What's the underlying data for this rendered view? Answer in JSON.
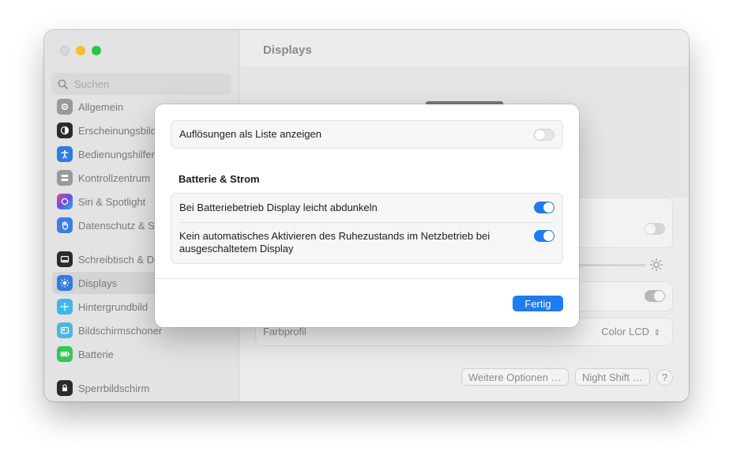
{
  "sidebar": {
    "search_placeholder": "Suchen",
    "items": [
      {
        "label": "Allgemein",
        "icon": "gear-icon",
        "color": "#9a9a9a"
      },
      {
        "label": "Erscheinungsbild",
        "icon": "appearance-icon",
        "color": "#2b2b2b"
      },
      {
        "label": "Bedienungshilfen",
        "icon": "accessibility-icon",
        "color": "#2f7be0"
      },
      {
        "label": "Kontrollzentrum",
        "icon": "control-center-icon",
        "color": "#9a9a9a"
      },
      {
        "label": "Siri & Spotlight",
        "icon": "siri-icon",
        "color": "#a04ddb"
      },
      {
        "label": "Datenschutz & Sicherheit",
        "icon": "hand-icon",
        "color": "#3a7ee6"
      },
      {
        "label": "Schreibtisch & Dock",
        "icon": "dock-icon",
        "color": "#2b2b2b"
      },
      {
        "label": "Displays",
        "icon": "sun-icon",
        "color": "#2f7be0"
      },
      {
        "label": "Hintergrundbild",
        "icon": "wallpaper-icon",
        "color": "#3fb8e8"
      },
      {
        "label": "Bildschirmschoner",
        "icon": "screensaver-icon",
        "color": "#4fb6e0"
      },
      {
        "label": "Batterie",
        "icon": "battery-icon",
        "color": "#34c759"
      },
      {
        "label": "Sperrbildschirm",
        "icon": "lock-icon",
        "color": "#2b2b2b"
      }
    ]
  },
  "content": {
    "title": "Displays",
    "farbprofil_label": "Farbprofil",
    "farbprofil_value": "Color LCD",
    "more_options_label": "Weitere Optionen …",
    "night_shift_label": "Night Shift …",
    "help_label": "?"
  },
  "sheet": {
    "list_toggle_label": "Auflösungen als Liste anzeigen",
    "list_toggle_on": false,
    "section_title": "Batterie & Strom",
    "dim_label": "Bei Batteriebetrieb Display leicht abdunkeln",
    "dim_on": true,
    "sleep_label": "Kein automatisches Aktivieren des Ruhezustands im Netzbetrieb bei ausgeschaltetem Display",
    "sleep_on": true,
    "done_label": "Fertig"
  },
  "colors": {
    "accent": "#1f7bf2",
    "traffic_close": "#d9d9d9",
    "traffic_min": "#febc2e",
    "traffic_max": "#28c840"
  }
}
